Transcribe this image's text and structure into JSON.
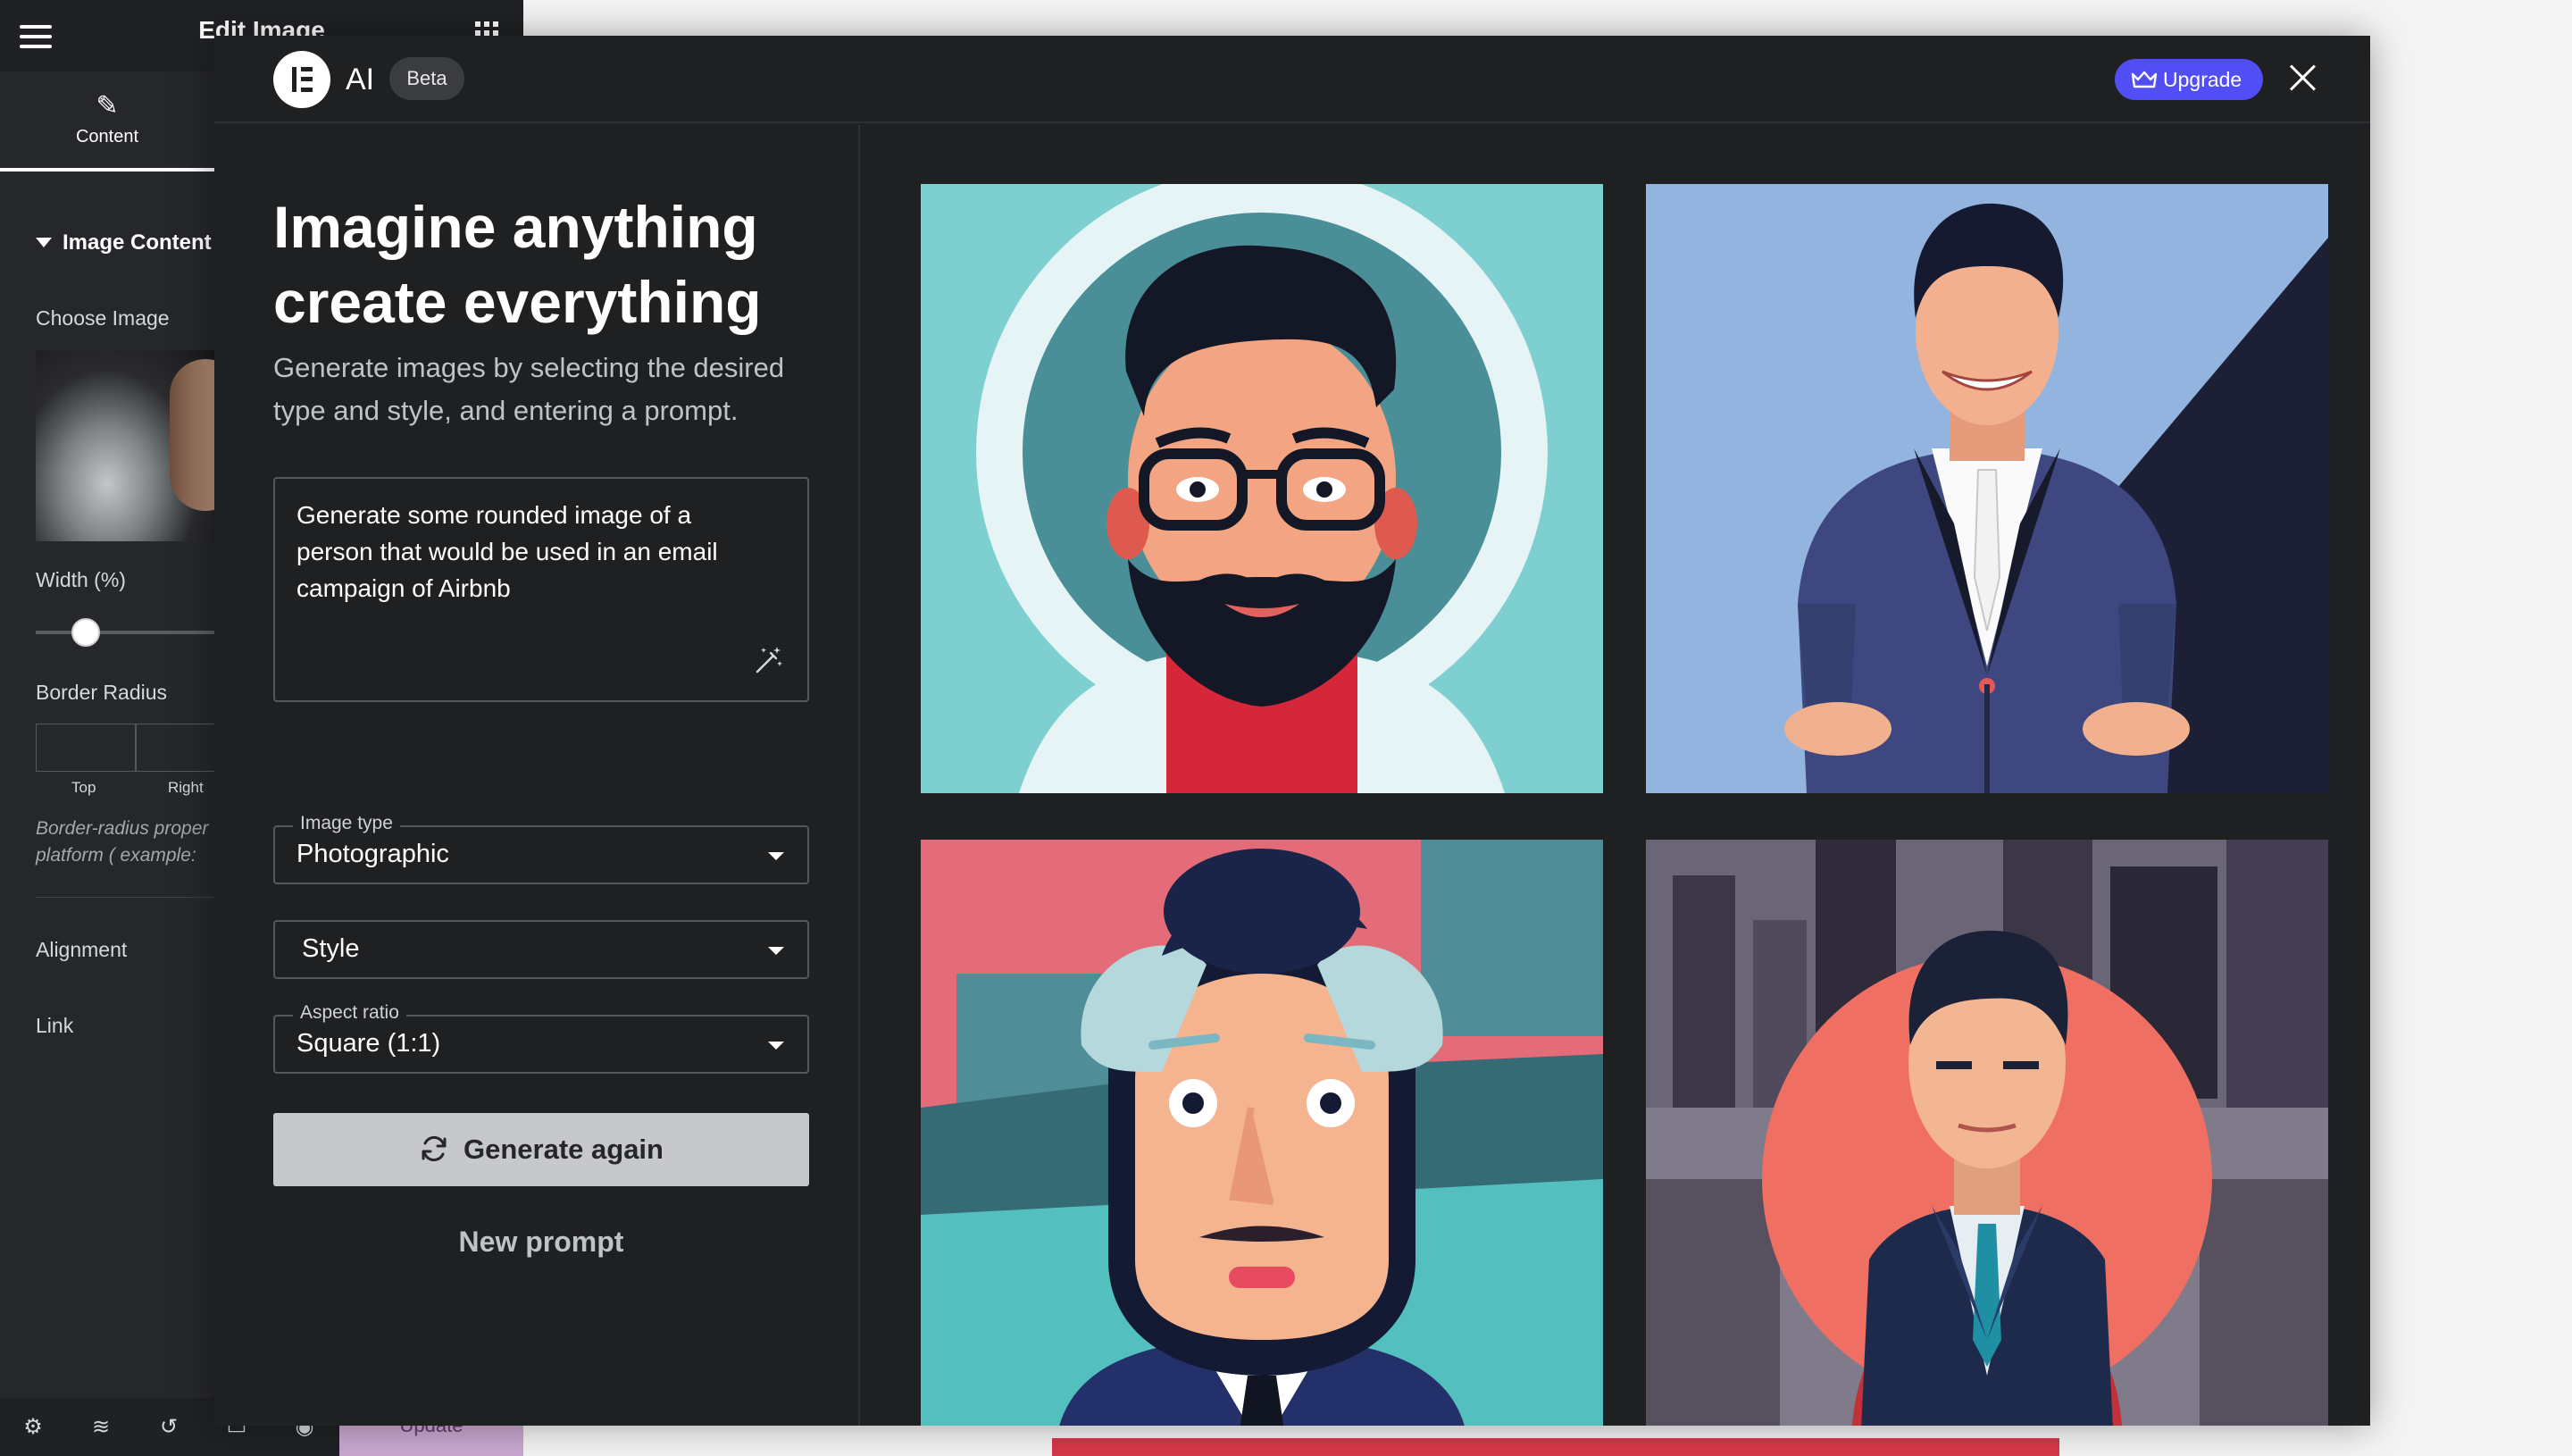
{
  "editor": {
    "title": "Edit Image",
    "tab_content": "Content",
    "section_title": "Image Content",
    "choose_image_label": "Choose Image",
    "width_label": "Width (%)",
    "width_value_fraction": 0.2,
    "border_radius_label": "Border Radius",
    "radius_top_label": "Top",
    "radius_right_label": "Right",
    "border_note_line1": "Border-radius proper",
    "border_note_line2": "platform ( example:",
    "alignment_label": "Alignment",
    "link_label": "Link",
    "update_label": "Update",
    "footer_icons": [
      "gear-icon",
      "layers-icon",
      "history-icon",
      "responsive-icon",
      "preview-icon"
    ]
  },
  "ai_modal": {
    "title": "AI",
    "badge": "Beta",
    "upgrade_label": "Upgrade",
    "headline_line1": "Imagine anything",
    "headline_line2": "create everything",
    "subtext": "Generate images by selecting the desired type and style, and entering a prompt.",
    "prompt_text": "Generate some rounded image of a person that would be used in an email campaign of Airbnb",
    "image_type": {
      "label": "Image type",
      "value": "Photographic"
    },
    "style": {
      "value": "Style"
    },
    "aspect_ratio": {
      "label": "Aspect ratio",
      "value": "Square (1:1)"
    },
    "generate_again_label": "Generate again",
    "new_prompt_label": "New prompt",
    "colors": {
      "accent": "#524ef5",
      "modal_bg": "#1f2022",
      "button_bg": "#c7c8ca"
    }
  }
}
